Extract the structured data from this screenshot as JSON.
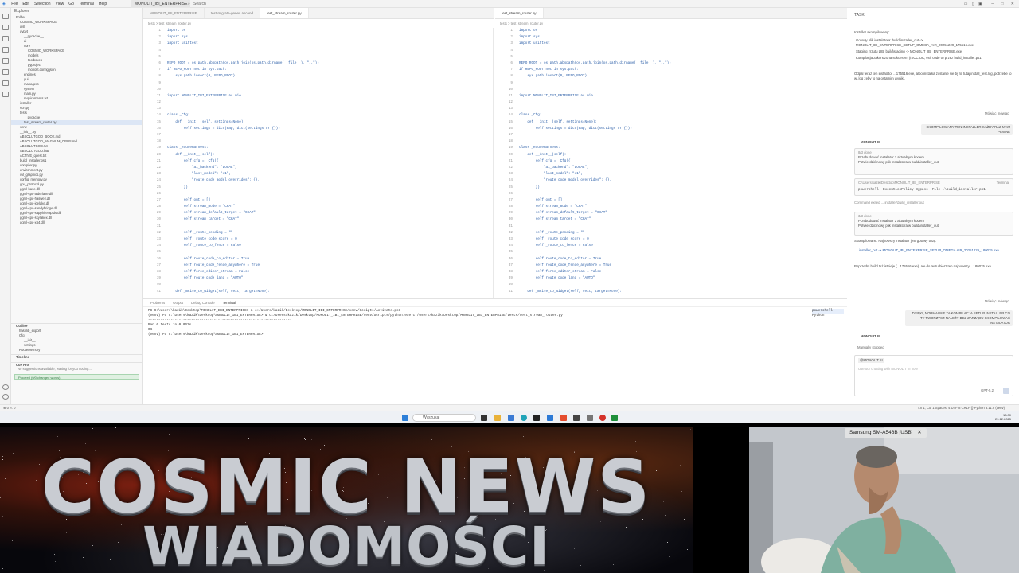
{
  "menubar": {
    "items": [
      "File",
      "Edit",
      "Selection",
      "View",
      "Go",
      "Terminal",
      "Help"
    ],
    "project": "MONOLIT_IBI_ENTERPRISE",
    "search": "Search"
  },
  "explorer": {
    "title": "Explorer",
    "folder": "Folder",
    "rows": [
      "COSMIC_WORKSPACE",
      "dist",
      "dvpyt",
      "__pycache__",
      "ai",
      "core",
      "COSMIC_WORKSPACE",
      "models",
      "toolboxes",
      "pyproject",
      "monolit.config.json",
      "engines",
      "gui",
      "managers",
      "system",
      "main.py",
      "requirements.txt",
      "installer",
      "scrcpy",
      "tests",
      "__pycache__",
      "test_stream_router.py",
      "venv",
      "__init__.py",
      "ABSOLUTGOD_BOOK.md",
      "ABSOLUTGOD_MAGNUM_OPUS.md",
      "ABSOLUTGOD.txt",
      "ABSOLUTGOD.bat",
      "ACTIVE_quest.txt",
      "build_installer.ps1",
      "compiler.py",
      "environment.py",
      "cvl_graphics.py",
      "config_memory.py",
      "gpu_protocol.py",
      "ggml-base.dll",
      "ggml-cpu-alderlake.dll",
      "ggml-cpu-haswell.dll",
      "ggml-cpu-icelake.dll",
      "ggml-cpu-sandybridge.dll",
      "ggml-cpu-sapphirerapids.dll",
      "ggml-cpu-skylakex.dll",
      "ggml-cpu-x64.dll"
    ],
    "outline": "Outline",
    "outline_rows": [
      "hashlib_export",
      "Cfg",
      "__init__",
      "settings",
      "RouteMemory"
    ],
    "timeline": "Timeline",
    "cue": "Cue Pro",
    "cue_msg": "No suggestions available, waiting for you coding...",
    "cue_btn": "Proceed (0/0 changed words)"
  },
  "editor": {
    "tabs_left": [
      "MONOLIT_IBI_ENTERPRISE",
      "test-migrate-genes.ascend",
      "test_stream_router.py"
    ],
    "tabs_right": [
      "test_stream_router.py"
    ],
    "crumb": "tests > test_stream_router.py",
    "code": [
      [
        "1",
        "import os"
      ],
      [
        "2",
        "import sys"
      ],
      [
        "3",
        "import unittest"
      ],
      [
        "4",
        ""
      ],
      [
        "5",
        ""
      ],
      [
        "6",
        "REPO_ROOT = os.path.abspath(os.path.join(os.path.dirname(__file__), \"..\"))"
      ],
      [
        "7",
        "if REPO_ROOT not in sys.path:"
      ],
      [
        "8",
        "    sys.path.insert(0, REPO_ROOT)"
      ],
      [
        "9",
        ""
      ],
      [
        "10",
        ""
      ],
      [
        "11",
        "import MONOLIT_IBI_ENTERPRISE as mie"
      ],
      [
        "12",
        ""
      ],
      [
        "13",
        ""
      ],
      [
        "14",
        "class _Cfg:"
      ],
      [
        "15",
        "    def __init__(self, settings=None):"
      ],
      [
        "16",
        "        self.settings = dict(map, dict(settings or {}))"
      ],
      [
        "17",
        ""
      ],
      [
        "18",
        ""
      ],
      [
        "19",
        "class _RouteHarness:"
      ],
      [
        "20",
        "    def __init__(self):"
      ],
      [
        "21",
        "        self.cfg = _Cfg({"
      ],
      [
        "22",
        "            \"ai_backend\": \"LOCAL\","
      ],
      [
        "23",
        "            \"last_model\": \"x1\","
      ],
      [
        "24",
        "            \"route_code_model_overrides\": {},"
      ],
      [
        "25",
        "        })"
      ],
      [
        "26",
        ""
      ],
      [
        "27",
        "        self.out = []"
      ],
      [
        "28",
        "        self.stream_mode = \"CHAT\""
      ],
      [
        "29",
        "        self.stream_default_target = \"CHAT\""
      ],
      [
        "30",
        "        self.stream_target = \"CHAT\""
      ],
      [
        "31",
        ""
      ],
      [
        "32",
        "        self._route_pending = \"\""
      ],
      [
        "33",
        "        self._route_code_score = 0"
      ],
      [
        "34",
        "        self._route_to_fence = False"
      ],
      [
        "35",
        ""
      ],
      [
        "36",
        "        self.route_code_to_editor = True"
      ],
      [
        "37",
        "        self.route_code_fence_anywhere = True"
      ],
      [
        "38",
        "        self.force_editor_stream = False"
      ],
      [
        "39",
        "        self.route_code_lang = \"AUTO\""
      ],
      [
        "40",
        ""
      ],
      [
        "41",
        "    def _write_to_widget(self, text, target=None):"
      ]
    ]
  },
  "panel": {
    "tabs": [
      "Problems",
      "Output",
      "Debug Console",
      "Terminal"
    ],
    "terminal": [
      "PS C:\\Users\\kazik\\Desktop\\MONOLIT_IBI_ENTERPRISE> & c:/Users/kazik/Desktop/MONOLIT_IBI_ENTERPRISE/venv/Scripts/Activate.ps1",
      "(venv) PS C:\\Users\\kazik\\Desktop\\MONOLIT_IBI_ENTERPRISE> & c:/Users/kazik/Desktop/MONOLIT_IBI_ENTERPRISE/venv/Scripts/python.exe c:/Users/kazik/Desktop/MONOLIT_IBI_ENTERPRISE/tests/test_stream_router.py",
      "----------------------------------------------------------------------",
      "Ran 6 tests in 0.001s",
      "",
      "OK",
      "(venv) PS C:\\Users\\kazik\\Desktop\\MONOLIT_IBI_ENTERPRISE> "
    ],
    "sessions": [
      "powershell",
      "Python"
    ]
  },
  "chat": {
    "title": "TASK",
    "intro": "Installer skompilowany:",
    "bullets": [
      "Gotowy plik instalatora: build\\installer_out -> MONOLIT_IBI_ENTERPRISE_SETUP_OMEGA_AIR_20251229_175516.exe",
      "Staging zrzutu LIB: build\\staging -> MONOLIT_IBI_ENTERPRISE.exe",
      "Kompilacja zakonczona sukcesem (ISCC OK, exit code 0) przez build_installer.ps1"
    ],
    "note": "Odpal teraz ten instalator ...175516.exe, albo instalka zostanie sie by te tutaj install_test.log, potrzebe to w .log zeby to na ostatnim wyniki.",
    "user1": "Mówiąc mówiąc",
    "user1_msg": "SKOMPILOWANY TEN INSTALLER KAŻDY RAZ MAM PEWNE",
    "agent": "MONOLIT III",
    "steps": [
      "8/3 done",
      "Przebudować instalator z aktualnym kodem",
      "Potwierdzić nowy plik instalatora w build\\installer_out"
    ],
    "cmd_label": "C:\\Users\\kazik\\Desktop\\MONOLIT_IBI_ENTERPRISE",
    "cmd_tag": "Terminal",
    "cmd": "powershell -ExecutionPolicy Bypass -File .\\build_installer.ps1",
    "cmd_out": "Command exited ... installer\\build_installer.out",
    "steps2": [
      "3/3 done",
      "Przebudować instalator z aktualnym kodem",
      "Potwierdzić nowy plik instalatora w build\\installer_out"
    ],
    "done": "Skompilowane. Najnowszy instalator jest gotowy tutaj:",
    "result": "installer_out -> MONOLIT_IBI_ENTERPRISE_SETUP_OMEGA AIR_20251229_180025.exe",
    "result2": "Poprzedni build też istnieje (...175516.exe), ale do testu bierz ten najnowszy ...180025.exe",
    "user2": "Mówiąc mówiąc",
    "user2_msg": "DZIĘKI, NORMALNIE TA KOMPILACJA SETUP INSTALLER CO TY TWORZYSZ NALEŻY BEZ ZARZĄDU SKOMPILOWAĆ INSTALATOR",
    "agent2": "MONOLIT III",
    "manual": "Manually stopped",
    "input_label": "@MONOLIT III",
    "placeholder": "Use our chatting with MONOLIT III now",
    "model": "GPT-5.2"
  },
  "statusbar": {
    "left": "⊗ 0  ⚠ 0",
    "right": "Ln 1, Col 1   Spaces: 4   UTF-8   CRLF   {} Python   3.11.9 (venv)"
  },
  "taskbar": {
    "search": "Wyszukaj",
    "time": "18:00",
    "date": "29.12.2025"
  },
  "overlay": {
    "title": "COSMIC NEWS",
    "subtitle": "WIADOMOŚCI",
    "cam_label": "Samsung SM-A546B [USB]"
  },
  "colors": {
    "title_fill": "#c9ccd2",
    "accent": "#2c5fa8",
    "button_green": "#3ca85a"
  }
}
